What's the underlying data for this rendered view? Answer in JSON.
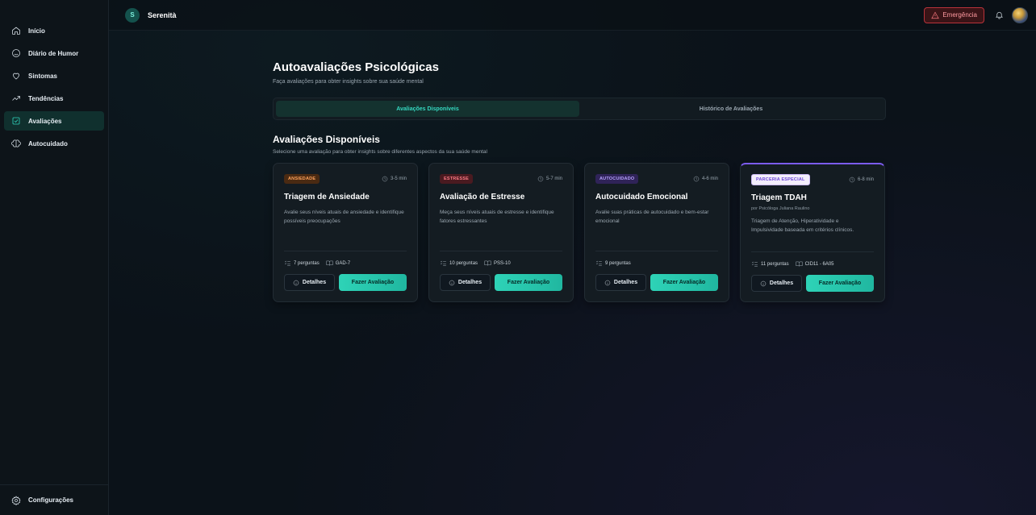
{
  "app": {
    "logo_letter": "S",
    "name": "Serenità"
  },
  "sidebar": {
    "items": [
      {
        "label": "Início",
        "icon": "home-icon",
        "active": false
      },
      {
        "label": "Diário de Humor",
        "icon": "smile-icon",
        "active": false
      },
      {
        "label": "Sintomas",
        "icon": "heart-icon",
        "active": false
      },
      {
        "label": "Tendências",
        "icon": "trend-icon",
        "active": false
      },
      {
        "label": "Avaliações",
        "icon": "checkbox-icon",
        "active": true
      },
      {
        "label": "Autocuidado",
        "icon": "brain-icon",
        "active": false
      }
    ],
    "settings_label": "Configurações"
  },
  "header": {
    "emergency_label": "Emergência"
  },
  "page": {
    "title": "Autoavaliações Psicológicas",
    "subtitle": "Faça avaliações para obter insights sobre sua saúde mental"
  },
  "tabs": [
    {
      "label": "Avaliações Disponíveis",
      "active": true
    },
    {
      "label": "Histórico de Avaliações",
      "active": false
    }
  ],
  "section": {
    "title": "Avaliações Disponíveis",
    "subtitle": "Selecione uma avaliação para obter insights sobre diferentes aspectos da sua saúde mental"
  },
  "cards": [
    {
      "badge": "ANSIEDADE",
      "duration": "3-5 min",
      "title": "Triagem de Ansiedade",
      "by": "",
      "description": "Avalie seus níveis atuais de ansiedade e identifique possíveis preocupações",
      "questions": "7 perguntas",
      "reference": "GAD-7",
      "details_label": "Detalhes",
      "action_label": "Fazer Avaliação"
    },
    {
      "badge": "ESTRESSE",
      "duration": "5-7 min",
      "title": "Avaliação de Estresse",
      "by": "",
      "description": "Meça seus níveis atuais de estresse e identifique fatores estressantes",
      "questions": "10 perguntas",
      "reference": "PSS-10",
      "details_label": "Detalhes",
      "action_label": "Fazer Avaliação"
    },
    {
      "badge": "AUTOCUIDADO",
      "duration": "4-6 min",
      "title": "Autocuidado Emocional",
      "by": "",
      "description": "Avalie suas práticas de autocuidado e bem-estar emocional",
      "questions": "9 perguntas",
      "reference": "",
      "details_label": "Detalhes",
      "action_label": "Fazer Avaliação"
    },
    {
      "badge": "PARCERIA ESPECIAL",
      "duration": "6-8 min",
      "title": "Triagem TDAH",
      "by": "por Psicóloga Juliana Raulino",
      "description": "Triagem de Atenção, Hiperatividade e Impulsividade baseada em critérios clínicos.",
      "questions": "11 perguntas",
      "reference": "CID11 - 6A05",
      "details_label": "Detalhes",
      "action_label": "Fazer Avaliação"
    }
  ],
  "colors": {
    "accent": "#2ed3b7",
    "emergency": "#b8323a",
    "special": "#7c5cf0"
  }
}
